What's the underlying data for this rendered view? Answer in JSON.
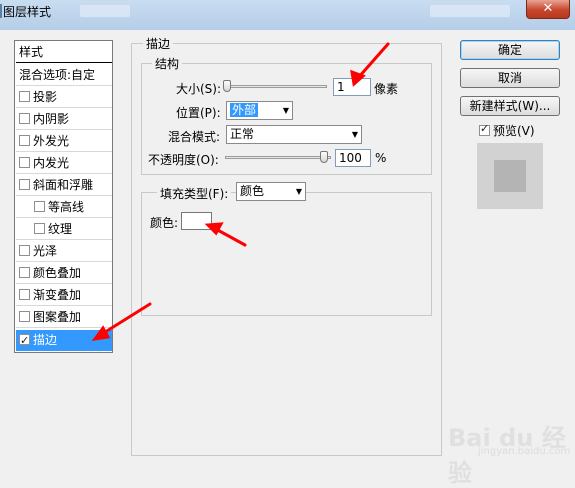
{
  "window": {
    "title": "图层样式",
    "close_glyph": "✕"
  },
  "styles_panel": {
    "header": "样式",
    "items": [
      {
        "label": "混合选项:自定",
        "checkbox": false,
        "checked": false,
        "indent": false,
        "selected": false
      },
      {
        "label": "投影",
        "checkbox": true,
        "checked": false,
        "indent": false,
        "selected": false
      },
      {
        "label": "内阴影",
        "checkbox": true,
        "checked": false,
        "indent": false,
        "selected": false
      },
      {
        "label": "外发光",
        "checkbox": true,
        "checked": false,
        "indent": false,
        "selected": false
      },
      {
        "label": "内发光",
        "checkbox": true,
        "checked": false,
        "indent": false,
        "selected": false
      },
      {
        "label": "斜面和浮雕",
        "checkbox": true,
        "checked": false,
        "indent": false,
        "selected": false
      },
      {
        "label": "等高线",
        "checkbox": true,
        "checked": false,
        "indent": true,
        "selected": false
      },
      {
        "label": "纹理",
        "checkbox": true,
        "checked": false,
        "indent": true,
        "selected": false
      },
      {
        "label": "光泽",
        "checkbox": true,
        "checked": false,
        "indent": false,
        "selected": false
      },
      {
        "label": "颜色叠加",
        "checkbox": true,
        "checked": false,
        "indent": false,
        "selected": false
      },
      {
        "label": "渐变叠加",
        "checkbox": true,
        "checked": false,
        "indent": false,
        "selected": false
      },
      {
        "label": "图案叠加",
        "checkbox": true,
        "checked": false,
        "indent": false,
        "selected": false
      },
      {
        "label": "描边",
        "checkbox": true,
        "checked": true,
        "indent": false,
        "selected": true
      }
    ]
  },
  "stroke": {
    "group_title": "描边",
    "structure_title": "结构",
    "size_label": "大小(S):",
    "size_value": "1",
    "size_unit": "像素",
    "position_label": "位置(P):",
    "position_value": "外部",
    "blend_label": "混合模式:",
    "blend_value": "正常",
    "opacity_label": "不透明度(O):",
    "opacity_value": "100",
    "opacity_unit": "%",
    "fill_type_label": "填充类型(F):",
    "fill_type_value": "颜色",
    "color_label": "颜色:",
    "color_value": "#ffffff"
  },
  "buttons": {
    "ok": "确定",
    "cancel": "取消",
    "new_style": "新建样式(W)...",
    "preview_label": "预览(V)",
    "preview_checked": true
  },
  "watermark": {
    "text": "Bai du 经验",
    "url": "jingyan.baidu.com"
  },
  "colors": {
    "selection": "#3399ff",
    "annotation_arrow": "#ff0000",
    "close_button": "#c7462c"
  }
}
